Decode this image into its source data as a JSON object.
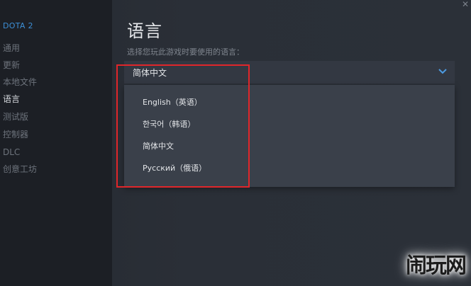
{
  "sidebar": {
    "game_title": "DOTA 2",
    "items": [
      {
        "label": "通用"
      },
      {
        "label": "更新"
      },
      {
        "label": "本地文件"
      },
      {
        "label": "语言"
      },
      {
        "label": "测试版"
      },
      {
        "label": "控制器"
      },
      {
        "label": "DLC"
      },
      {
        "label": "创意工坊"
      }
    ],
    "active_index": 3
  },
  "main": {
    "title": "语言",
    "description": "选择您玩此游戏时要使用的语言：",
    "language_select": {
      "selected": "简体中文",
      "options": [
        {
          "label": "English（英语）"
        },
        {
          "label": "한국어（韩语）"
        },
        {
          "label": "简体中文"
        },
        {
          "label": "Русский（俄语）"
        }
      ]
    }
  },
  "close_icon": "close-icon",
  "watermark": "闹玩网",
  "colors": {
    "accent": "#3d8fd6",
    "highlight": "#e0262a",
    "sidebar_bg": "#1c1f25",
    "dropdown_bg": "#3a404a"
  }
}
